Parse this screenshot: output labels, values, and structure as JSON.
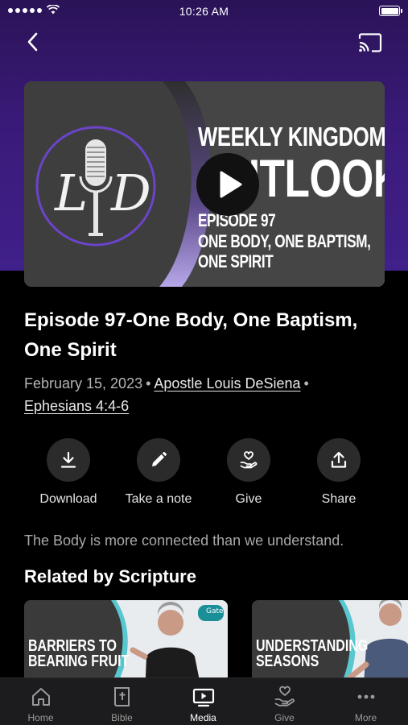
{
  "status_bar": {
    "time": "10:26 AM"
  },
  "header": {
    "back_icon": "chevron-left-icon",
    "cast_icon": "cast-icon"
  },
  "thumbnail": {
    "logo_letters": [
      "L",
      "D"
    ],
    "show_title_line1": "WEEKLY KINGDOM",
    "show_title_line2": "OUTLOOK",
    "episode_line": "EPISODE 97",
    "subtitle_line1": "ONE BODY, ONE BAPTISM,",
    "subtitle_line2": "ONE SPIRIT",
    "accent_color": "#8a6fd1"
  },
  "episode": {
    "title": "Episode 97-One Body, One Baptism, One Spirit",
    "date": "February 15, 2023",
    "separator": "•",
    "speaker": "Apostle Louis DeSiena",
    "scripture": "Ephesians 4:4-6",
    "description": "The Body is more connected than we understand."
  },
  "actions": [
    {
      "label": "Download",
      "icon": "download-icon"
    },
    {
      "label": "Take a note",
      "icon": "pencil-icon"
    },
    {
      "label": "Give",
      "icon": "give-heart-hand-icon"
    },
    {
      "label": "Share",
      "icon": "share-icon"
    }
  ],
  "related": {
    "section_title": "Related by Scripture",
    "items": [
      {
        "title_line1": "BARRIERS TO",
        "title_line2": "BEARING FRUIT",
        "badge": "Gate"
      },
      {
        "title_line1": "UNDERSTANDING",
        "title_line2": "SEASONS"
      }
    ]
  },
  "tab_bar": {
    "active": "Media",
    "tabs": [
      {
        "label": "Home",
        "icon": "home-icon"
      },
      {
        "label": "Bible",
        "icon": "bible-icon"
      },
      {
        "label": "Media",
        "icon": "media-icon"
      },
      {
        "label": "Give",
        "icon": "give-icon"
      },
      {
        "label": "More",
        "icon": "more-dots-icon"
      }
    ]
  },
  "colors": {
    "header_purple": "#3a1a78",
    "background": "#000000",
    "tab_bar": "#1c1c1e"
  }
}
